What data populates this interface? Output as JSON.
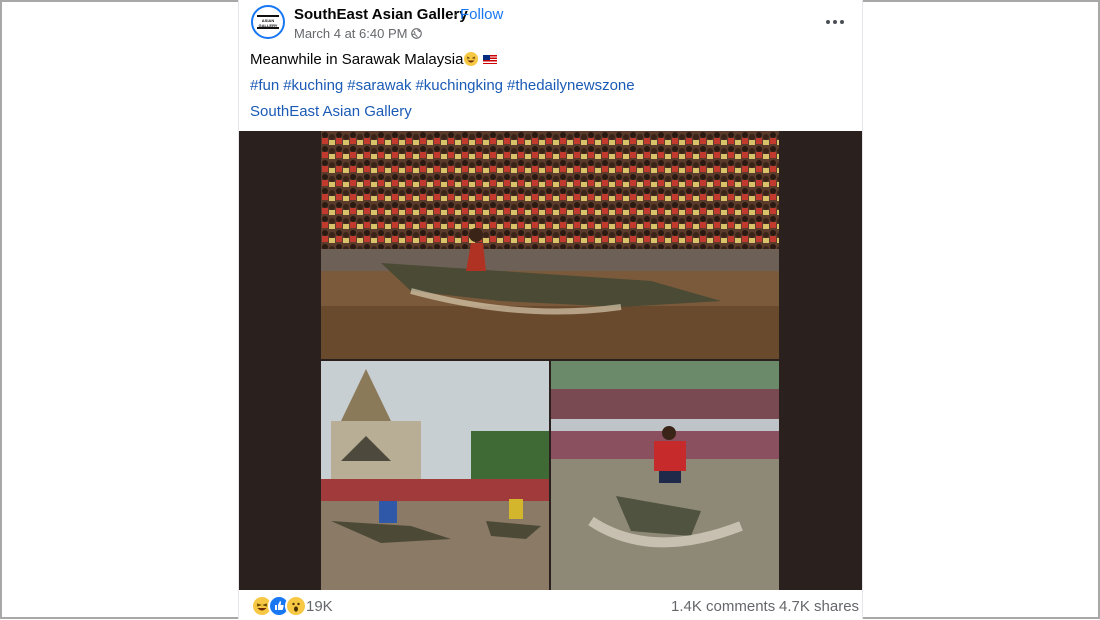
{
  "post": {
    "page_name": "SouthEast Asian Gallery",
    "separator": "·",
    "follow_label": "Follow",
    "date": "March 4 at 6:40 PM ·",
    "avatar_text": "ASIAN GALLERY",
    "caption": "Meanwhile in Sarawak Malaysia",
    "hashtags": [
      "#fun",
      "#kuching",
      "#sarawak",
      "#kuchingking",
      "#thedailynewszone"
    ],
    "gallery_link": "SouthEast Asian Gallery"
  },
  "media": {
    "photos": [
      "crowd-crocodile-race",
      "mosque-river-crocodile-riders",
      "red-shirt-crocodile-rider"
    ]
  },
  "footer": {
    "reactions": [
      "haha",
      "like",
      "wow"
    ],
    "reaction_count": "19K",
    "comments": "1.4K comments",
    "shares": "4.7K shares"
  },
  "colors": {
    "link": "#1b5bb5",
    "follow": "#1877f2",
    "secondary_text": "#65676b"
  }
}
